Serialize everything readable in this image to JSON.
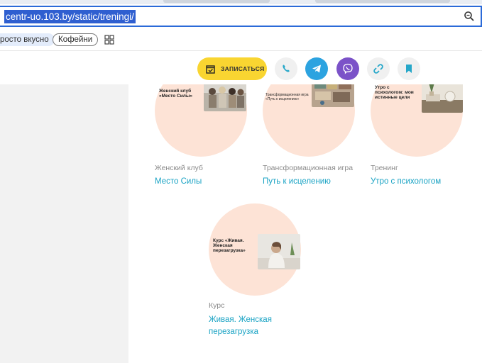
{
  "browser": {
    "url": "centr-uo.103.by/static/treningi/",
    "bookmarks": [
      "росто вкусно",
      "Кофейни"
    ]
  },
  "header": {
    "signup_label": "ЗАПИСАТЬСЯ",
    "signup_color": "#f9d531",
    "social": [
      "phone-icon",
      "telegram-icon",
      "viber-icon",
      "link-icon",
      "bookmark-icon"
    ]
  },
  "cards": [
    {
      "image_caption": "Женский клуб «Место Силы»",
      "category": "Женский клуб",
      "title": "Место Силы"
    },
    {
      "image_caption": "Трансформационная игра «Путь к исцелению»",
      "category": "Трансформационная игра",
      "title": "Путь к исцелению"
    },
    {
      "image_caption": "Утро с психологом: мои истинные цели",
      "category": "Тренинг",
      "title": "Утро с психологом"
    },
    {
      "image_caption": "Курс «Живая. Женская перезагрузка»",
      "category": "Курс",
      "title": "Живая. Женская перезагрузка"
    }
  ],
  "colors": {
    "accent": "#1aa3c4",
    "circle": "#fde3d6",
    "telegram": "#2ca3e0",
    "viber": "#7b52c8"
  }
}
